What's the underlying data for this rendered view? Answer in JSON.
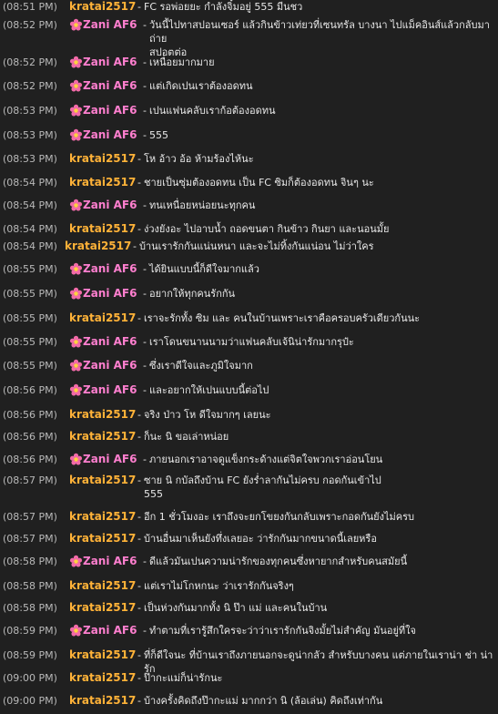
{
  "messages": [
    {
      "time": "(08:51 PM)",
      "user": "kratai2517",
      "kind": "orange",
      "lines": [
        "FC รอพ่อยยะ กำลังจิ๋มอยู่ 555 มีนชว"
      ]
    },
    {
      "time": "(08:52 PM)",
      "user": "Zani AF6",
      "kind": "pink",
      "lines": [
        "วันนี้ไปทาสปอนเซอร์ แล้วกินข้าวเท่ยวที่เซนทรัล บางนา ไปแม็คอินส์แล้วกลับมาถ่าย",
        "สปอตต่อ"
      ]
    },
    {
      "time": "(08:52 PM)",
      "user": "Zani AF6",
      "kind": "pink",
      "lines": [
        "เหนื่อยมากมาย"
      ]
    },
    {
      "time": "(08:52 PM)",
      "user": "Zani AF6",
      "kind": "pink",
      "lines": [
        "แต่เกิดเปนเราต้องอดทน"
      ]
    },
    {
      "time": "(08:53 PM)",
      "user": "Zani AF6",
      "kind": "pink",
      "lines": [
        "เปนแฟนคลับเราก้อต้องอดทน"
      ]
    },
    {
      "time": "(08:53 PM)",
      "user": "Zani AF6",
      "kind": "pink",
      "lines": [
        "555"
      ]
    },
    {
      "time": "(08:53 PM)",
      "user": "kratai2517",
      "kind": "orange",
      "lines": [
        "โห อ้าว อ้อ ห้ามร้องไห้นะ"
      ]
    },
    {
      "time": "(08:54 PM)",
      "user": "kratai2517",
      "kind": "orange",
      "lines": [
        "ชายเป็นซุ่มต้องอดทน เป็น FC ซิมก็ต้องอดทน จินๆ นะ"
      ]
    },
    {
      "time": "(08:54 PM)",
      "user": "Zani AF6",
      "kind": "pink",
      "lines": [
        "ทนเหนื่อยหน่อยนะทุกคน"
      ]
    },
    {
      "time": "(08:54 PM)",
      "user": "kratai2517",
      "kind": "orange",
      "lines": [
        "ง่วงยังอะ ไปอาบน้ำ ถอดขนตา กินข้าว กินยา และนอนมั้ย"
      ]
    },
    {
      "time": "(08:54 PM)",
      "user": "kratai2517",
      "kind": "orange",
      "compact": true,
      "lines": [
        "บ้านเรารักกันแน่นหนา และจะไม่ทิ้งกันแน่อน ไม่ว่าใคร"
      ]
    },
    {
      "time": "(08:55 PM)",
      "user": "Zani AF6",
      "kind": "pink",
      "lines": [
        "ได้ยินแบบนี้ก็ดีใจมากแล้ว"
      ]
    },
    {
      "time": "(08:55 PM)",
      "user": "Zani AF6",
      "kind": "pink",
      "lines": [
        "อยากให้ทุกคนรักกัน"
      ]
    },
    {
      "time": "(08:55 PM)",
      "user": "kratai2517",
      "kind": "orange",
      "lines": [
        "เราจะรักทั้ง ซิม และ คนในบ้านเพราะเราคือครอบครัวเดียวกันนะ"
      ]
    },
    {
      "time": "(08:55 PM)",
      "user": "Zani AF6",
      "kind": "pink",
      "lines": [
        "เราโดนขนานนามว่าแฟนคลับเจ้นิน่ารักมากรุป๋ะ"
      ]
    },
    {
      "time": "(08:55 PM)",
      "user": "Zani AF6",
      "kind": "pink",
      "lines": [
        "ซึ่งเราดีใจและภูมิใจมาก"
      ]
    },
    {
      "time": "(08:56 PM)",
      "user": "Zani AF6",
      "kind": "pink",
      "lines": [
        "และอยากให้เปนแบบนี้ต่อไป"
      ]
    },
    {
      "time": "(08:56 PM)",
      "user": "kratai2517",
      "kind": "orange",
      "lines": [
        "จริง ป่าว โห ดีใจมากๆ เลยนะ"
      ]
    },
    {
      "time": "(08:56 PM)",
      "user": "kratai2517",
      "kind": "orange",
      "lines": [
        "ก็นะ นิ ขอเล่าหน่อย"
      ]
    },
    {
      "time": "(08:56 PM)",
      "user": "Zani AF6",
      "kind": "pink",
      "lines": [
        "ภายนอกเราอาจดูแข็งกระด้างแต่จิตใจพวกเราอ่อนโยน"
      ]
    },
    {
      "time": "(08:57 PM)",
      "user": "kratai2517",
      "kind": "orange",
      "lines": [
        "ซาย นิ กบัลถึงบ้าน FC ยังร่ำลากันไม่ครบ กอดกันเข้าไป",
        "555"
      ]
    },
    {
      "time": "(08:57 PM)",
      "user": "kratai2517",
      "kind": "orange",
      "lines": [
        "อีก 1 ชั่วโมงอะ เราถึงจะยกโขยงกันกลับเพราะกอดกันยังไม่ครบ"
      ]
    },
    {
      "time": "(08:57 PM)",
      "user": "kratai2517",
      "kind": "orange",
      "lines": [
        "บ้านอื่นมาเห็นยังทึ่งเลยอะ ว่ารักกันมากขนาดนี้เลยหรือ"
      ]
    },
    {
      "time": "(08:58 PM)",
      "user": "Zani AF6",
      "kind": "pink",
      "lines": [
        "ดีแล้วมันเปนความน่ารักของทุกคนซึ่งหายากสำหรับคนสมัยนี้"
      ]
    },
    {
      "time": "(08:58 PM)",
      "user": "kratai2517",
      "kind": "orange",
      "lines": [
        "แต่เราไม่โกหกนะ ว่าเรารักกันจริงๆ"
      ]
    },
    {
      "time": "(08:58 PM)",
      "user": "kratai2517",
      "kind": "orange",
      "lines": [
        "เป็นห่วงกันมากทั้ง นิ ป๊า แม่ และคนในบ้าน"
      ]
    },
    {
      "time": "(08:59 PM)",
      "user": "Zani AF6",
      "kind": "pink",
      "lines": [
        "ทำตามที่เรารู้สึกใครจะว่าว่าเรารักกันจิงมั้ยไม่สำคัญ มันอยู่ที่ใจ"
      ]
    },
    {
      "time": "(08:59 PM)",
      "user": "kratai2517",
      "kind": "orange",
      "lines": [
        "ที่ก็ดีใจนะ ที่บ้านเราถึงภายนอกจะดูน่ากลัว สำหรับบางคน แต่ภายในเราน่า ช่า น่ารัก"
      ]
    },
    {
      "time": "(09:00 PM)",
      "user": "kratai2517",
      "kind": "orange",
      "lines": [
        "ป๊ากะแม่ก็น่ารักนะ"
      ]
    },
    {
      "time": "(09:00 PM)",
      "user": "kratai2517",
      "kind": "orange",
      "lines": [
        "บ้างครั้งคิดถึงป๊ากะแม่ มากกว่า นิ (ล้อเล่น) คิดถึงเท่ากัน"
      ]
    }
  ]
}
